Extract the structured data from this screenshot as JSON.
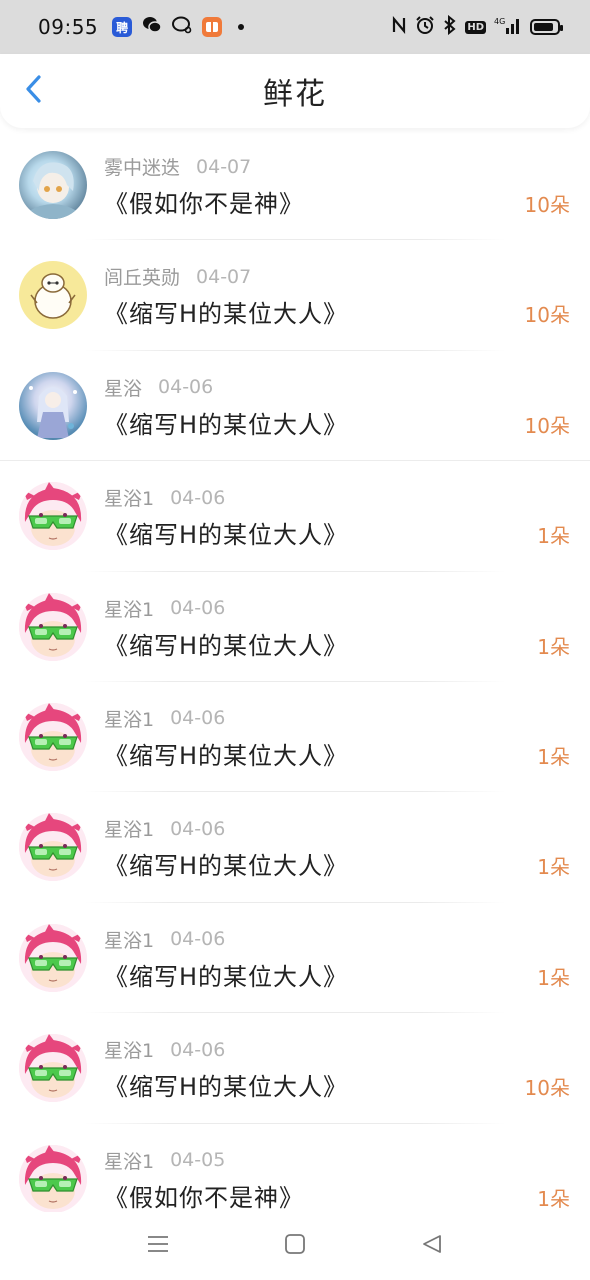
{
  "status_bar": {
    "time": "09:55",
    "apps": [
      {
        "icon": "pinduoduo-app-icon",
        "glyph": "聘"
      },
      {
        "icon": "wechat-icon",
        "glyph": ""
      },
      {
        "icon": "chat-bubble-icon",
        "glyph": ""
      },
      {
        "icon": "orange-app-icon",
        "glyph": ""
      }
    ],
    "network": "4G",
    "hd": "HD"
  },
  "header": {
    "title": "鲜花",
    "back_icon": "chevron-left-icon"
  },
  "colors": {
    "accent": "#3a8ee6",
    "count": "#e38a4f"
  },
  "items": [
    {
      "name": "雾中迷迭",
      "date": "04-07",
      "work": "《假如你不是神》",
      "count": "10朵",
      "avatar": "av-a"
    },
    {
      "name": "闾丘英勋",
      "date": "04-07",
      "work": "《缩写H的某位大人》",
      "count": "10朵",
      "avatar": "av-b"
    },
    {
      "name": "星浴",
      "date": "04-06",
      "work": "《缩写H的某位大人》",
      "count": "10朵",
      "avatar": "av-c"
    },
    {
      "name": "星浴1",
      "date": "04-06",
      "work": "《缩写H的某位大人》",
      "count": "1朵",
      "avatar": "av-d"
    },
    {
      "name": "星浴1",
      "date": "04-06",
      "work": "《缩写H的某位大人》",
      "count": "1朵",
      "avatar": "av-d"
    },
    {
      "name": "星浴1",
      "date": "04-06",
      "work": "《缩写H的某位大人》",
      "count": "1朵",
      "avatar": "av-d"
    },
    {
      "name": "星浴1",
      "date": "04-06",
      "work": "《缩写H的某位大人》",
      "count": "1朵",
      "avatar": "av-d"
    },
    {
      "name": "星浴1",
      "date": "04-06",
      "work": "《缩写H的某位大人》",
      "count": "1朵",
      "avatar": "av-d"
    },
    {
      "name": "星浴1",
      "date": "04-06",
      "work": "《缩写H的某位大人》",
      "count": "10朵",
      "avatar": "av-d"
    },
    {
      "name": "星浴1",
      "date": "04-05",
      "work": "《假如你不是神》",
      "count": "1朵",
      "avatar": "av-d"
    }
  ],
  "nav": {
    "menu_icon": "menu-icon",
    "home_icon": "home-square-icon",
    "back_icon": "back-triangle-icon"
  }
}
